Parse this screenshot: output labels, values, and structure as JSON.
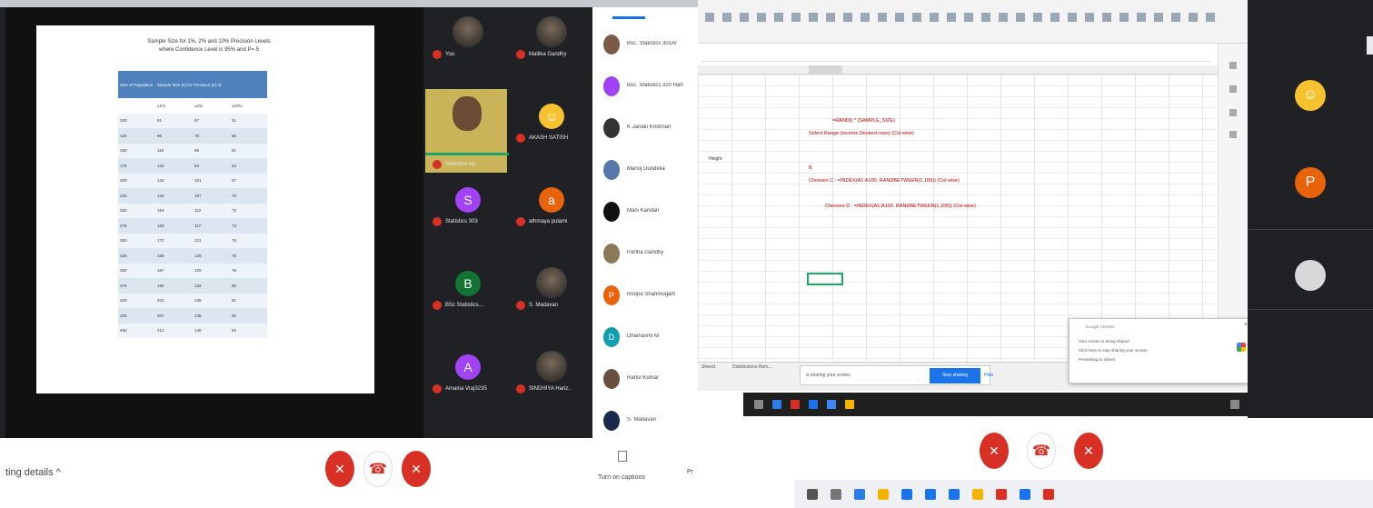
{
  "slide": {
    "title_line1": "Sample Size for 1%, 2% and 10% Precision Levels",
    "title_line2": "where Confidence Level is 95% and P=.5",
    "header_col1": "Size of Population",
    "header_group": "Sample Size (n) for Precision (e) of:",
    "subheaders": [
      "±1%",
      "±2%",
      "±10%"
    ],
    "rows": [
      [
        "100",
        "81",
        "67",
        "51"
      ],
      [
        "125",
        "96",
        "78",
        "56"
      ],
      [
        "150",
        "110",
        "86",
        "61"
      ],
      [
        "175",
        "122",
        "94",
        "64"
      ],
      [
        "200",
        "134",
        "101",
        "67"
      ],
      [
        "225",
        "144",
        "107",
        "70"
      ],
      [
        "250",
        "154",
        "112",
        "72"
      ],
      [
        "275",
        "163",
        "117",
        "73"
      ],
      [
        "300",
        "172",
        "121",
        "76"
      ],
      [
        "325",
        "180",
        "125",
        "76"
      ],
      [
        "350",
        "187",
        "129",
        "78"
      ],
      [
        "375",
        "194",
        "132",
        "80"
      ],
      [
        "400",
        "201",
        "135",
        "81"
      ],
      [
        "425",
        "207",
        "138",
        "82"
      ],
      [
        "450",
        "212",
        "140",
        "82"
      ]
    ]
  },
  "tiles": [
    {
      "name": "You",
      "type": "photo"
    },
    {
      "name": "Mallika Gandhy",
      "type": "photo"
    },
    {
      "name": "Statistics Ad",
      "type": "active"
    },
    {
      "name": "AKASH SATISH",
      "type": "avatar",
      "letter": "☺",
      "color": "#f6c230"
    },
    {
      "name": "Statistics 303",
      "type": "avatar",
      "letter": "S",
      "color": "#a142f4"
    },
    {
      "name": "athmaya pulami",
      "type": "avatar",
      "letter": "a",
      "color": "#e8630a"
    },
    {
      "name": "BSc Statistics...",
      "type": "avatar",
      "letter": "B",
      "color": "#137333"
    },
    {
      "name": "S. Madavan",
      "type": "photo"
    },
    {
      "name": "Amaina Vraj3235",
      "type": "avatar",
      "letter": "A",
      "color": "#a142f4"
    },
    {
      "name": "SINDHIYA Hariz..",
      "type": "photo"
    }
  ],
  "participants": [
    {
      "name": "Bsc. Statistics 301Ar",
      "letter": "",
      "color": "#7b5a4a"
    },
    {
      "name": "Bsc. Statistics 320 Harr",
      "letter": "",
      "color": "#a142f4"
    },
    {
      "name": "K Janaki Krishnan",
      "letter": "",
      "color": "#333333"
    },
    {
      "name": "Manoj Dundelia",
      "letter": "",
      "color": "#5577aa"
    },
    {
      "name": "Mani Kandan",
      "letter": "",
      "color": "#111111"
    },
    {
      "name": "Partha Gandhy",
      "letter": "",
      "color": "#8a7a5a"
    },
    {
      "name": "Roopa Shanmugam",
      "letter": "P",
      "color": "#e8630a"
    },
    {
      "name": "Dhanlaxmi M",
      "letter": "D",
      "color": "#129eaf"
    },
    {
      "name": "Rahul Kumar",
      "letter": "",
      "color": "#6a5040"
    },
    {
      "name": "S. Madavan",
      "letter": "",
      "color": "#1a2a4a"
    }
  ],
  "controls": {
    "meeting_details": "ting details",
    "meeting_details_chevron": "^",
    "captions_label": "Turn on captions",
    "partial_label": "Pr"
  },
  "sheet": {
    "cell_label": "Height",
    "formulas": [
      "=RAND() * (SAMPLE_SIZE)",
      "Select Range (Income Desired rows) (Col wise)",
      "B",
      "Chooses C : =INDEX(A1:A100, RANDBETWEEN(1,100)) (Col wise)",
      "Chooses D : =INDEX(A1:A100, RANDBETWEEN(1,100)) (Col wise)"
    ],
    "tabs": [
      "Sheet1",
      "Distributions Rem..."
    ],
    "share_text": "is sharing your screen",
    "stop_label": "Stop sharing",
    "hide_label": "Hide"
  },
  "notification": {
    "title": "Google Chrome",
    "line1": "Your screen is being shared",
    "line2": "Click here to stop sharing your screen",
    "line3": "Presenting to others",
    "close": "×"
  },
  "strip": [
    {
      "letter": "☺",
      "color": "#f6c230"
    },
    {
      "letter": "P",
      "color": "#e8630a"
    },
    {
      "letter": "",
      "color": "#d8d8d8"
    }
  ]
}
